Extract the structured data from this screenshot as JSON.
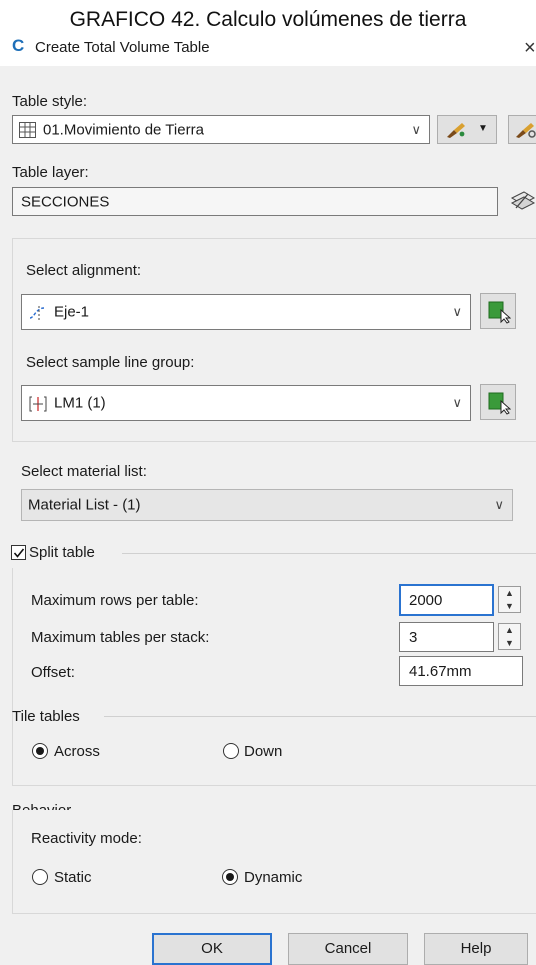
{
  "caption": "GRAFICO 42. Calculo volúmenes de tierra",
  "window": {
    "title": "Create Total Volume Table",
    "close": "×",
    "app_icon": "C"
  },
  "table_style": {
    "label": "Table style:",
    "value": "01.Movimiento de Tierra"
  },
  "table_layer": {
    "label": "Table layer:",
    "value": "SECCIONES"
  },
  "alignment": {
    "label": "Select alignment:",
    "value": "Eje-1"
  },
  "sample_line_group": {
    "label": "Select sample line group:",
    "value": "LM1 (1)"
  },
  "material_list": {
    "label": "Select material list:",
    "value": "Material List - (1)"
  },
  "split_table": {
    "label": "Split table",
    "checked": true,
    "max_rows_label": "Maximum rows per table:",
    "max_rows": "2000",
    "max_tables_label": "Maximum tables per stack:",
    "max_tables": "3",
    "offset_label": "Offset:",
    "offset": "41.67mm"
  },
  "tile_tables": {
    "label": "Tile tables",
    "across": "Across",
    "down": "Down",
    "selected": "Across"
  },
  "behavior": {
    "label": "Behavior",
    "reactivity_label": "Reactivity mode:",
    "static": "Static",
    "dynamic": "Dynamic",
    "selected": "Dynamic"
  },
  "buttons": {
    "ok": "OK",
    "cancel": "Cancel",
    "help": "Help"
  },
  "colors": {
    "accent": "#2a73d0",
    "pick_green": "#3a9a3a"
  }
}
